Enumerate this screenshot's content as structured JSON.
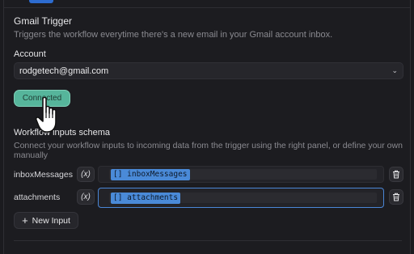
{
  "trigger": {
    "title": "Gmail Trigger",
    "description": "Triggers the workflow everytime there's a new email in your Gmail account inbox."
  },
  "account": {
    "label": "Account",
    "selected": "rodgetech@gmail.com",
    "status_button": "Connected"
  },
  "schema": {
    "title": "Workflow inputs schema",
    "description": "Connect your workflow inputs to incoming data from the trigger using the right panel, or define your own manually",
    "inputs": [
      {
        "name": "inboxMessages",
        "fx": "(x)",
        "token": "[] inboxMessages"
      },
      {
        "name": "attachments",
        "fx": "(x)",
        "token": "[] attachments"
      }
    ],
    "add_button": "New Input"
  },
  "colors": {
    "accent": "#56b59b",
    "token": "#4a8ad8",
    "focus": "#4a86d6",
    "background": "#1c1c20"
  }
}
